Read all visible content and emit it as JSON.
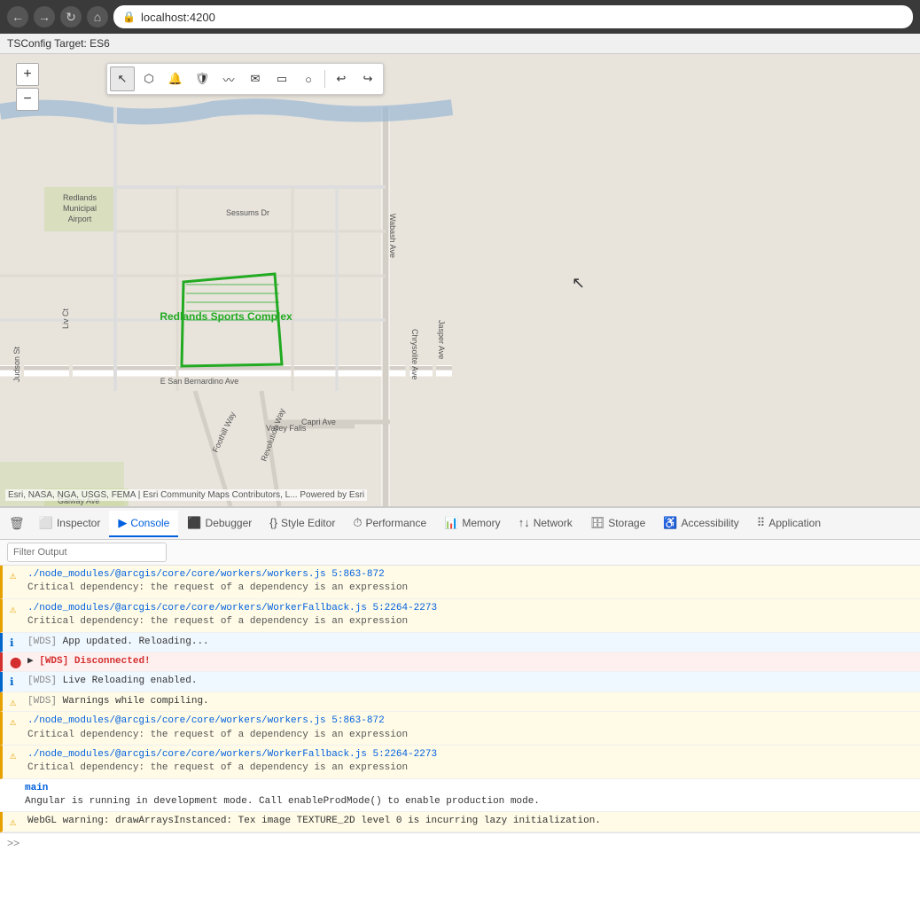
{
  "browser": {
    "url": "localhost:4200",
    "shield_icon": "🔒",
    "page_icon": "📄"
  },
  "page": {
    "header": "TSConfig Target: ES6"
  },
  "map": {
    "attribution": "Esri, NASA, NGA, USGS, FEMA | Esri Community Maps Contributors, L...   Powered by Esri",
    "label": "Redlands Sports Complex",
    "zoom_in": "+",
    "zoom_out": "−"
  },
  "toolbar_tools": [
    {
      "id": "select",
      "icon": "↖",
      "active": true
    },
    {
      "id": "lasso",
      "icon": "⬡",
      "active": false
    },
    {
      "id": "bell",
      "icon": "🔔",
      "active": false
    },
    {
      "id": "shield",
      "icon": "🛡",
      "active": false
    },
    {
      "id": "path",
      "icon": "〰",
      "active": false
    },
    {
      "id": "envelope",
      "icon": "✉",
      "active": false
    },
    {
      "id": "rect",
      "icon": "▭",
      "active": false
    },
    {
      "id": "circle",
      "icon": "○",
      "active": false
    },
    {
      "id": "undo",
      "icon": "↩",
      "active": false
    },
    {
      "id": "redo",
      "icon": "↪",
      "active": false
    }
  ],
  "devtools": {
    "tabs": [
      {
        "id": "pointer",
        "label": "",
        "icon": "↖",
        "active": false
      },
      {
        "id": "inspector",
        "label": "Inspector",
        "icon": "⬜",
        "active": false
      },
      {
        "id": "console",
        "label": "Console",
        "icon": "▶",
        "active": true
      },
      {
        "id": "debugger",
        "label": "Debugger",
        "icon": "⬛",
        "active": false
      },
      {
        "id": "style-editor",
        "label": "Style Editor",
        "icon": "{}",
        "active": false
      },
      {
        "id": "performance",
        "label": "Performance",
        "icon": "⏱",
        "active": false
      },
      {
        "id": "memory",
        "label": "Memory",
        "icon": "📊",
        "active": false
      },
      {
        "id": "network",
        "label": "Network",
        "icon": "↑↓",
        "active": false
      },
      {
        "id": "storage",
        "label": "Storage",
        "icon": "🗄",
        "active": false
      },
      {
        "id": "accessibility",
        "label": "Accessibility",
        "icon": "♿",
        "active": false
      },
      {
        "id": "application",
        "label": "Application",
        "icon": "⠿",
        "active": false
      }
    ],
    "filter_placeholder": "Filter Output",
    "messages": [
      {
        "type": "warning",
        "text": "./node_modules/@arcgis/core/core/workers/workers.js 5:863-872",
        "sub": "Critical dependency: the request of a dependency is an expression"
      },
      {
        "type": "warning",
        "text": "./node_modules/@arcgis/core/core/workers/WorkerFallback.js 5:2264-2273",
        "sub": "Critical dependency: the request of a dependency is an expression"
      },
      {
        "type": "info",
        "text": "[WDS] App updated. Reloading..."
      },
      {
        "type": "error",
        "text": "[WDS] Disconnected!"
      },
      {
        "type": "info",
        "text": "[WDS] Live Reloading enabled."
      },
      {
        "type": "warning",
        "text": "[WDS] Warnings while compiling."
      },
      {
        "type": "warning",
        "text": "./node_modules/@arcgis/core/core/workers/workers.js 5:863-872",
        "sub": "Critical dependency: the request of a dependency is an expression"
      },
      {
        "type": "warning",
        "text": "./node_modules/@arcgis/core/core/workers/WorkerFallback.js 5:2264-2273",
        "sub": "Critical dependency: the request of a dependency is an expression"
      },
      {
        "type": "plain",
        "tag": "main",
        "text": "Angular is running in development mode. Call enableProdMode() to enable production mode."
      },
      {
        "type": "warning",
        "text": "WebGL warning: drawArraysInstanced: Tex image TEXTURE_2D level 0 is incurring lazy initialization."
      }
    ]
  }
}
